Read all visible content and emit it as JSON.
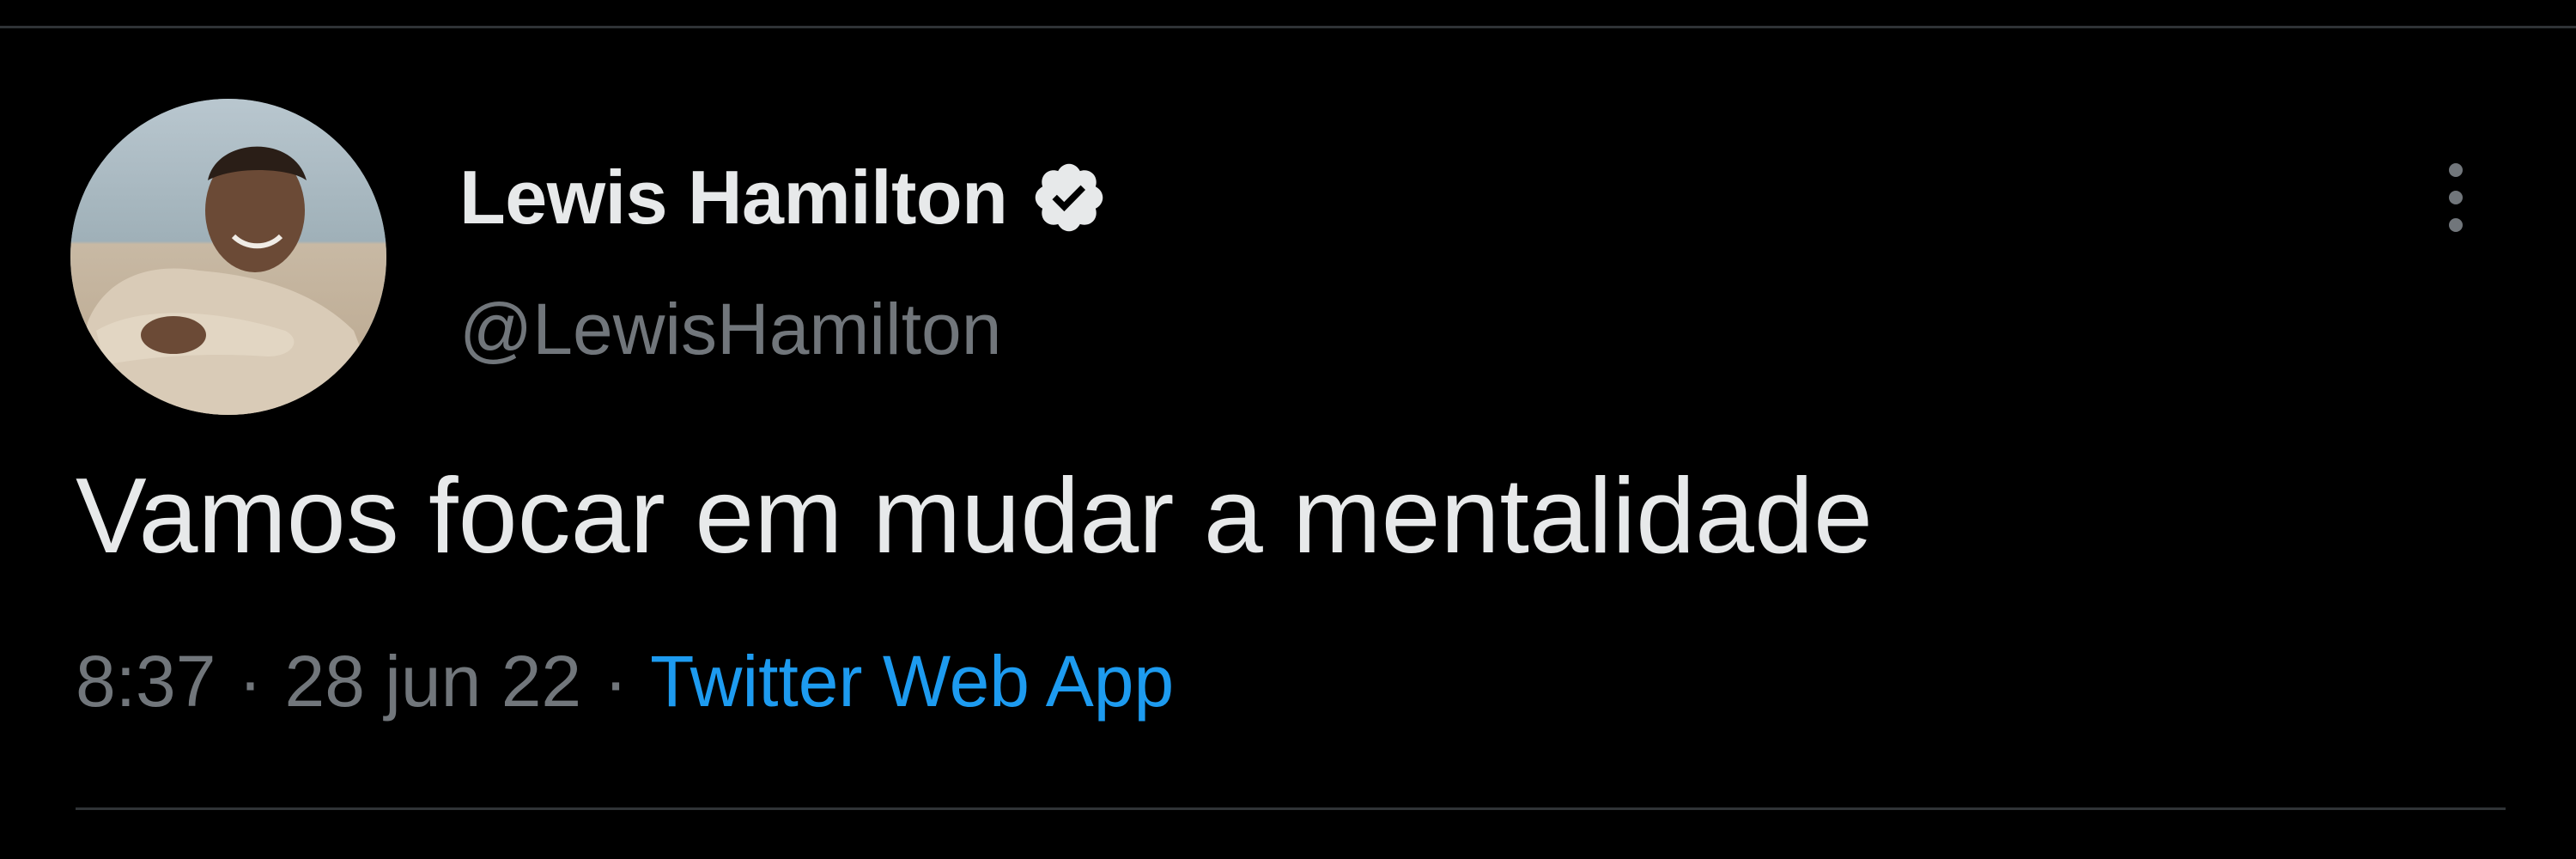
{
  "tweet": {
    "author": {
      "display_name": "Lewis Hamilton",
      "handle": "@LewisHamilton",
      "verified": true
    },
    "text": "Vamos focar em mudar a mentalidade",
    "meta": {
      "time": "8:37",
      "separator": "·",
      "date": "28 jun 22",
      "source": "Twitter Web App"
    },
    "icons": {
      "verified": "verified-badge-icon",
      "more": "more-vertical-icon"
    }
  },
  "colors": {
    "background": "#000000",
    "primary_text": "#e7e9ea",
    "secondary_text": "#71767b",
    "link": "#1d9bf0",
    "divider": "#2f3336"
  }
}
